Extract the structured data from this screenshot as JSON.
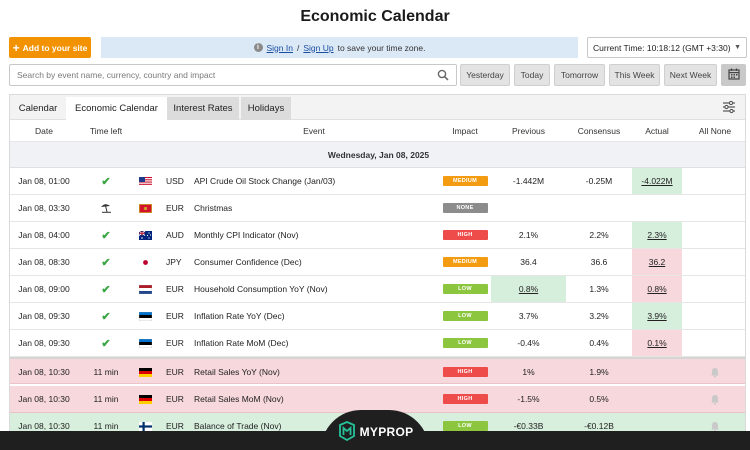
{
  "page": {
    "title": "Economic Calendar"
  },
  "toolbar": {
    "add_label": "Add to your site",
    "signin_link": "Sign In",
    "slash": "/",
    "signup_link": "Sign Up",
    "signin_suffix": "to save your time zone.",
    "current_time": "Current Time: 10:18:12 (GMT +3:30)"
  },
  "search": {
    "placeholder": "Search by event name, currency, country and impact"
  },
  "date_buttons": [
    "Yesterday",
    "Today",
    "Tomorrow",
    "This Week",
    "Next Week"
  ],
  "tabs": [
    "Calendar",
    "Economic Calendar",
    "Interest Rates",
    "Holidays"
  ],
  "columns": {
    "date": "Date",
    "time_left": "Time left",
    "event": "Event",
    "impact": "Impact",
    "previous": "Previous",
    "consensus": "Consensus",
    "actual": "Actual",
    "all_none": "All None"
  },
  "day_header": "Wednesday, Jan 08, 2025",
  "rows": [
    {
      "date": "Jan 08, 01:00",
      "time_left": "✔",
      "country": "US",
      "currency": "USD",
      "event": "API Crude Oil Stock Change (Jan/03)",
      "impact": "MEDIUM",
      "previous": "-1.442M",
      "consensus": "-0.25M",
      "actual": "-4.022M"
    },
    {
      "date": "Jan 08, 03:30",
      "time_left": "beach-icon",
      "country": "ME",
      "currency": "EUR",
      "event": "Christmas",
      "impact": "NONE",
      "previous": "",
      "consensus": "",
      "actual": ""
    },
    {
      "date": "Jan 08, 04:00",
      "time_left": "✔",
      "country": "AU",
      "currency": "AUD",
      "event": "Monthly CPI Indicator (Nov)",
      "impact": "HIGH",
      "previous": "2.1%",
      "consensus": "2.2%",
      "actual": "2.3%"
    },
    {
      "date": "Jan 08, 08:30",
      "time_left": "✔",
      "country": "JP",
      "currency": "JPY",
      "event": "Consumer Confidence (Dec)",
      "impact": "MEDIUM",
      "previous": "36.4",
      "consensus": "36.6",
      "actual": "36.2"
    },
    {
      "date": "Jan 08, 09:00",
      "time_left": "✔",
      "country": "NL",
      "currency": "EUR",
      "event": "Household Consumption YoY (Nov)",
      "impact": "LOW",
      "previous": "0.8%",
      "consensus": "1.3%",
      "actual": "0.8%"
    },
    {
      "date": "Jan 08, 09:30",
      "time_left": "✔",
      "country": "EE",
      "currency": "EUR",
      "event": "Inflation Rate YoY (Dec)",
      "impact": "LOW",
      "previous": "3.7%",
      "consensus": "3.2%",
      "actual": "3.9%"
    },
    {
      "date": "Jan 08, 09:30",
      "time_left": "✔",
      "country": "EE",
      "currency": "EUR",
      "event": "Inflation Rate MoM (Dec)",
      "impact": "LOW",
      "previous": "-0.4%",
      "consensus": "0.4%",
      "actual": "0.1%"
    },
    {
      "date": "Jan 08, 10:30",
      "time_left": "11 min",
      "country": "DE",
      "currency": "EUR",
      "event": "Retail Sales YoY (Nov)",
      "impact": "HIGH",
      "previous": "1%",
      "consensus": "1.9%",
      "actual": ""
    },
    {
      "date": "Jan 08, 10:30",
      "time_left": "11 min",
      "country": "DE",
      "currency": "EUR",
      "event": "Retail Sales MoM (Nov)",
      "impact": "HIGH",
      "previous": "-1.5%",
      "consensus": "0.5%",
      "actual": ""
    },
    {
      "date": "Jan 08, 10:30",
      "time_left": "11 min",
      "country": "FI",
      "currency": "EUR",
      "event": "Balance of Trade (Nov)",
      "impact": "LOW",
      "previous": "-€0.33B",
      "consensus": "-€0.12B",
      "actual": ""
    }
  ],
  "impact_colors": {
    "MEDIUM": "#f39c12",
    "NONE": "#8c8c8c",
    "HIGH": "#ee4b4b",
    "LOW": "#8cc63f"
  },
  "brand": {
    "logo_text": "MYPROP",
    "accent": "#26c39a"
  }
}
